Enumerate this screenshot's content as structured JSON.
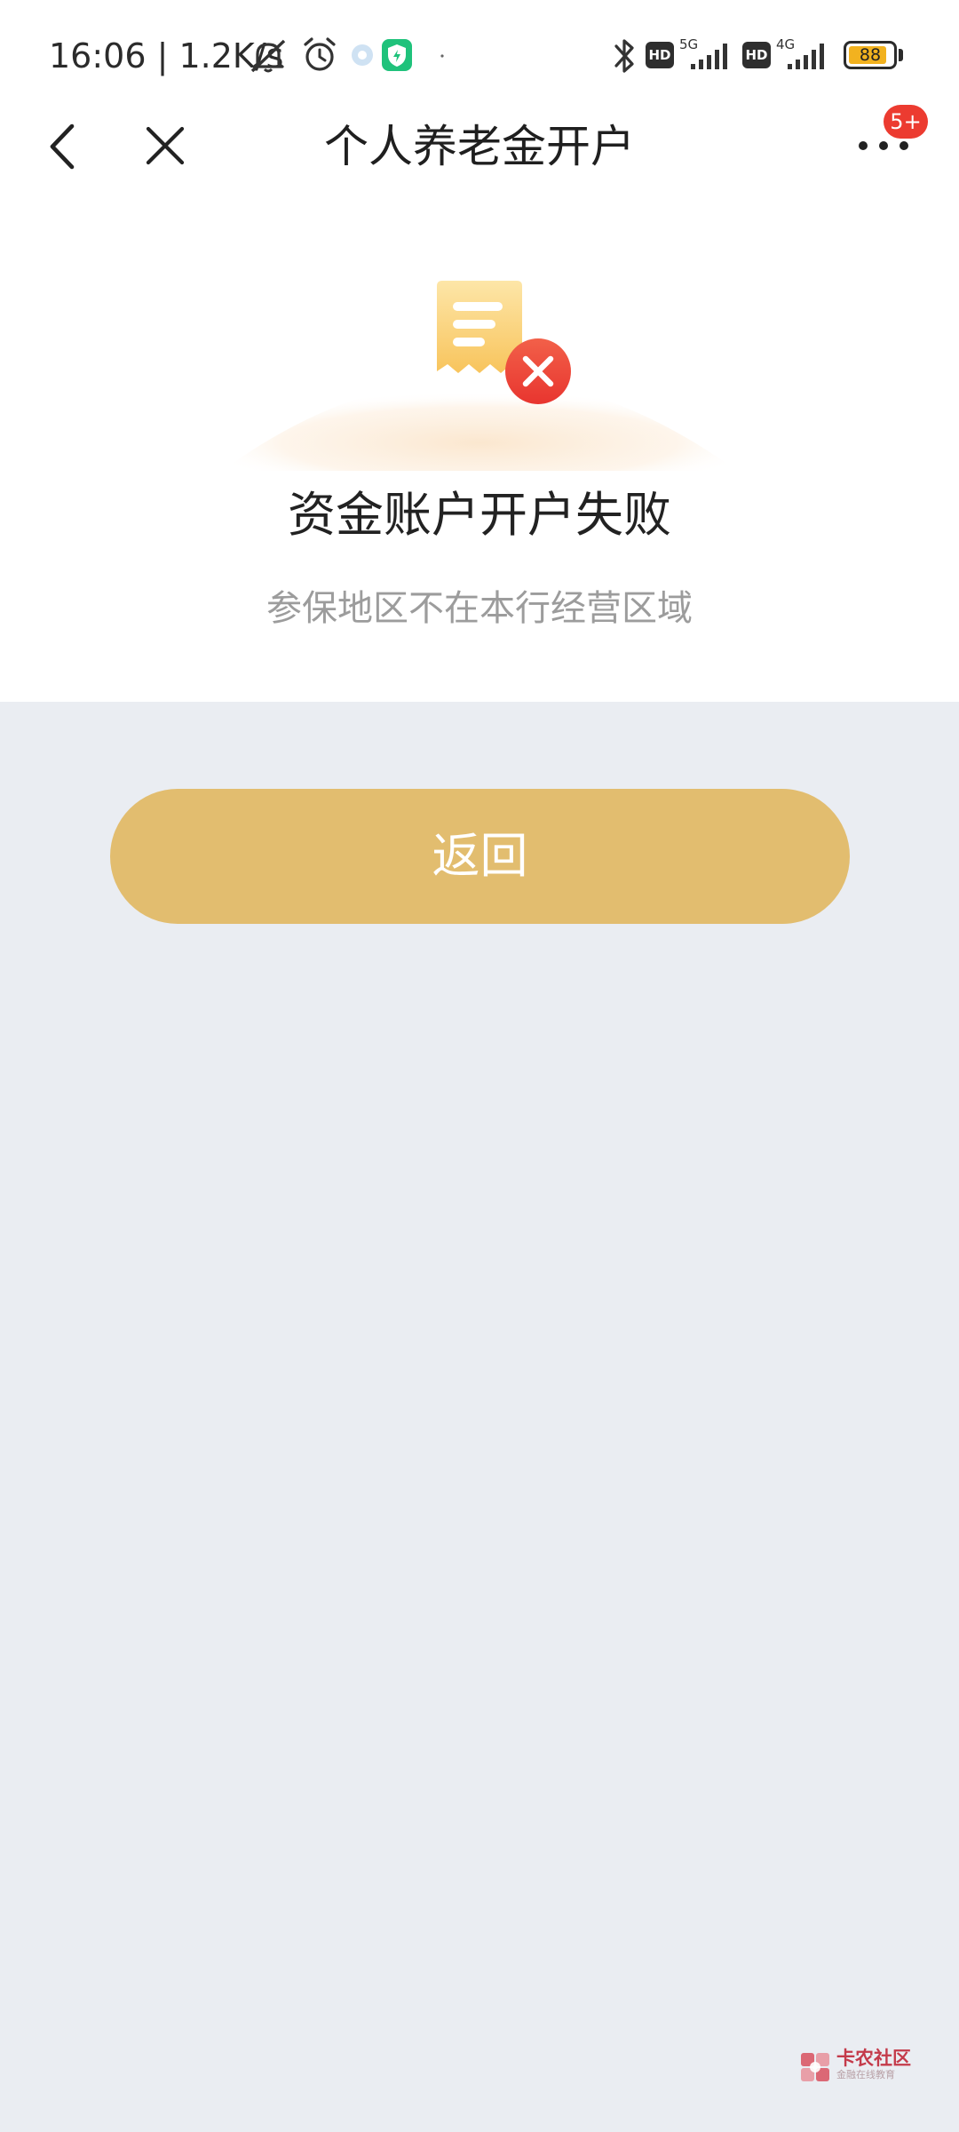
{
  "status_bar": {
    "time_speed": "16:06 | 1.2K/s",
    "network_1": "5G",
    "network_2": "4G",
    "hd_label": "HD",
    "battery_level": "88"
  },
  "nav": {
    "title": "个人养老金开户",
    "badge": "5+"
  },
  "result": {
    "title": "资金账户开户失败",
    "subtitle": "参保地区不在本行经营区域"
  },
  "actions": {
    "return_label": "返回"
  },
  "watermark": {
    "brand": "卡农社区",
    "tagline": "金融在线教育"
  },
  "colors": {
    "accent_button": "#e2bd6f",
    "error_red": "#ef4038",
    "badge_red": "#ec3b30",
    "page_bg": "#eaedf2",
    "battery_fill": "#f2b21f"
  }
}
